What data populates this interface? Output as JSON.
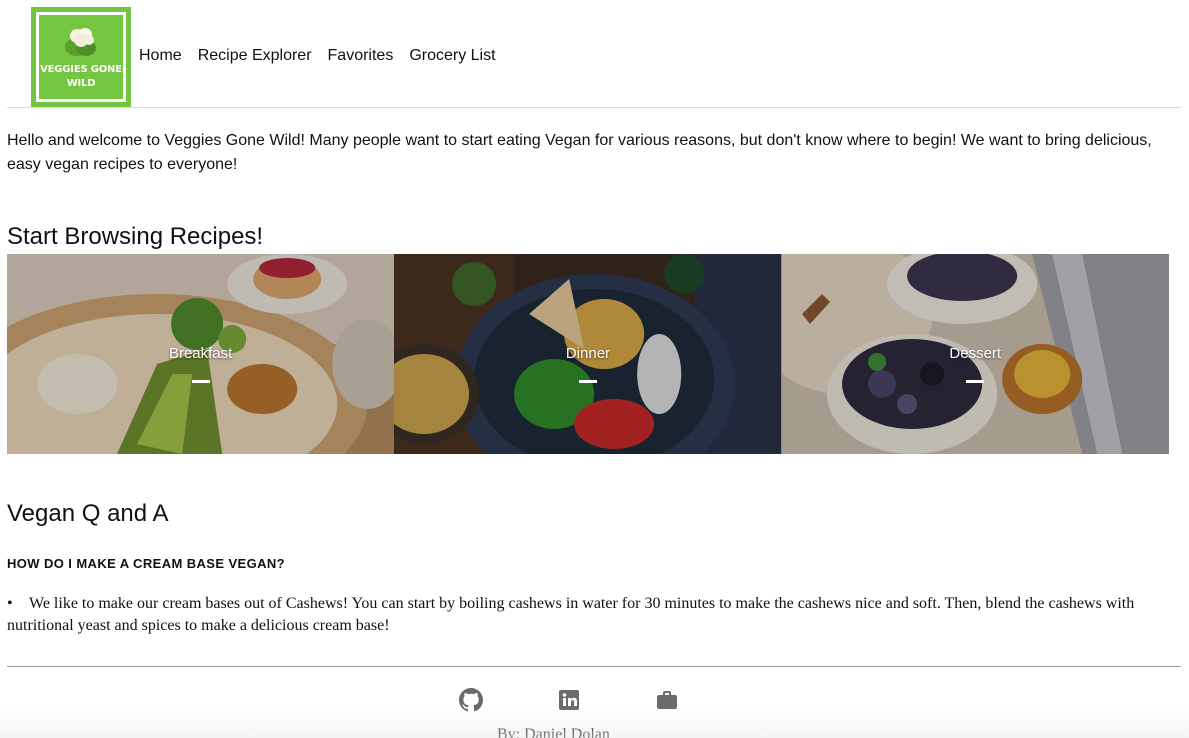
{
  "header": {
    "logo_text": "VEGGIES GONE WILD",
    "nav": [
      {
        "label": "Home"
      },
      {
        "label": "Recipe Explorer"
      },
      {
        "label": "Favorites"
      },
      {
        "label": "Grocery List"
      }
    ]
  },
  "intro": {
    "text": "Hello and welcome to Veggies Gone Wild! Many people want to start eating Vegan for various reasons, but don't know where to begin! We want to bring delicious, easy vegan recipes to everyone!"
  },
  "browse": {
    "heading": "Start Browsing Recipes!",
    "cards": [
      {
        "label": "Breakfast",
        "image": "breakfast-avocado-bowl"
      },
      {
        "label": "Dinner",
        "image": "dinner-chickpea-bowl"
      },
      {
        "label": "Dessert",
        "image": "dessert-berry-parfait"
      }
    ]
  },
  "qa": {
    "heading": "Vegan Q and A",
    "question": "HOW DO I MAKE A CREAM BASE VEGAN?",
    "bullet": "•",
    "answer": "We like to make our cream bases out of Cashews! You can start by boiling cashews in water for 30 minutes to make the cashews nice and soft. Then, blend the cashews with nutritional yeast and spices to make a delicious cream base!"
  },
  "footer": {
    "icons": [
      "github-icon",
      "linkedin-icon",
      "briefcase-icon"
    ],
    "byline": "By: Daniel Dolan"
  },
  "colors": {
    "logo_green": "#74c53f",
    "icon_gray": "#6b6b6b"
  }
}
